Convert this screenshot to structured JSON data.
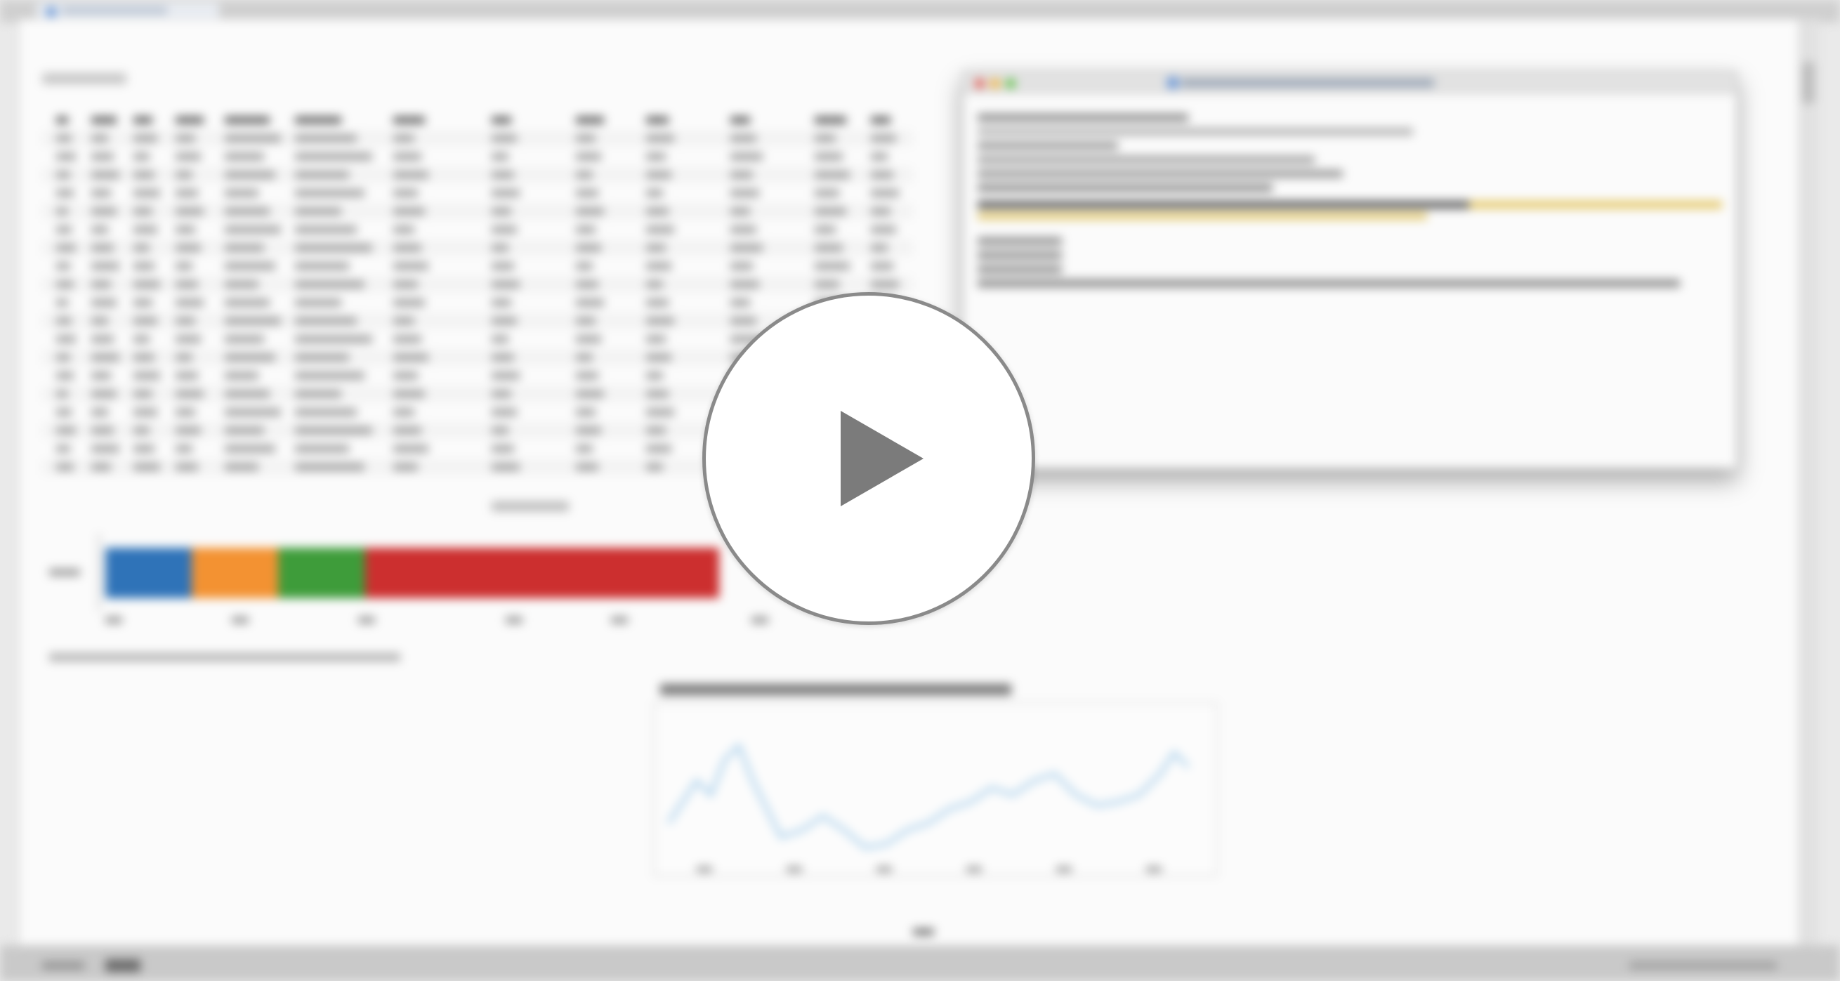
{
  "screen": {
    "description_label": ""
  },
  "overlay": {
    "play_icon": "play-icon"
  },
  "stacked_bar": {
    "segments": [
      {
        "name": "seg1",
        "fraction": 0.11,
        "color": "#2f73b8"
      },
      {
        "name": "seg2",
        "fraction": 0.11,
        "color": "#f39232"
      },
      {
        "name": "seg3",
        "fraction": 0.11,
        "color": "#3e9c3a"
      },
      {
        "name": "seg4",
        "fraction": 0.45,
        "color": "#cc2f2f"
      }
    ]
  },
  "line_chart": {
    "color": "#8ec1e6"
  },
  "ide": {
    "button_colors": [
      "#e5594f",
      "#f3b234",
      "#59c13f"
    ]
  }
}
